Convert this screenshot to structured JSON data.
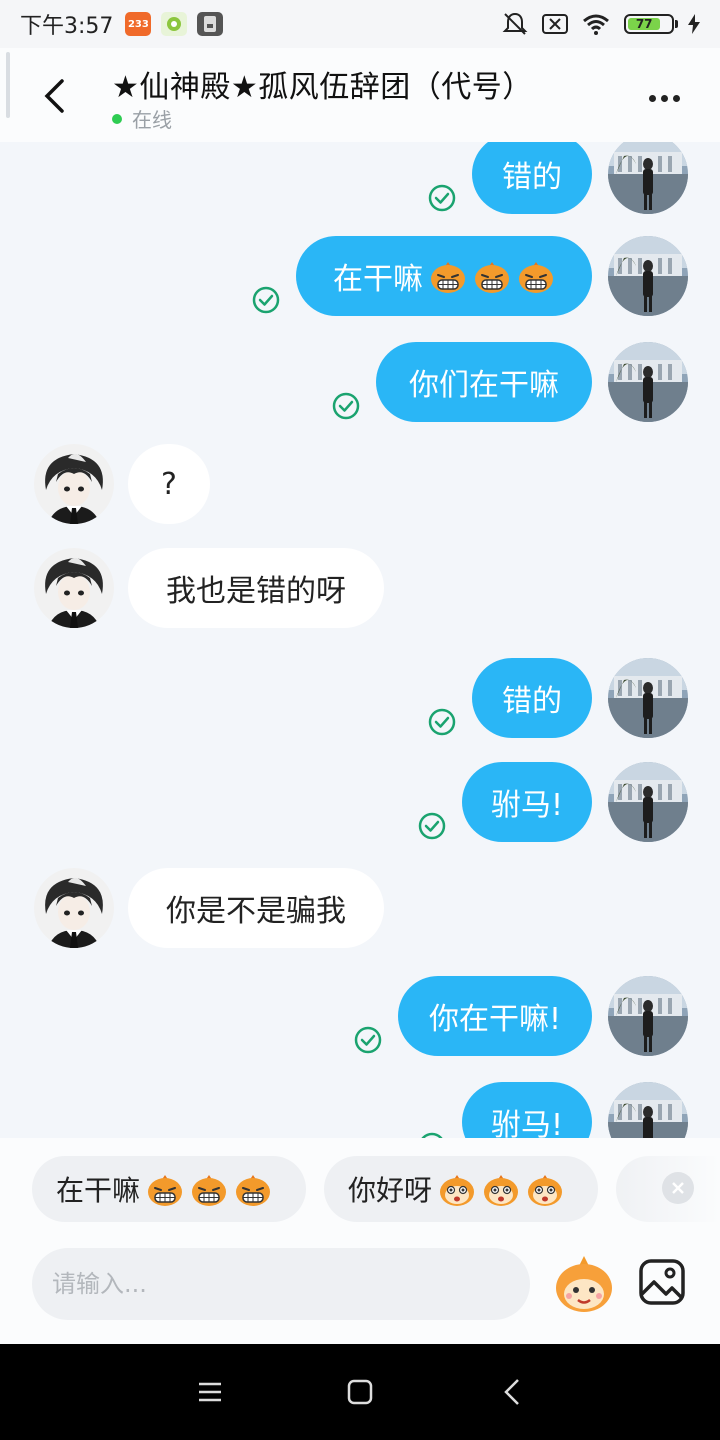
{
  "status_bar": {
    "time": "下午3:57",
    "app_badge": "233",
    "battery_level": "77"
  },
  "header": {
    "title": "★仙神殿★孤风伍辞团（代号）",
    "status": "在线",
    "online_color": "#2ecc52"
  },
  "colors": {
    "outgoing_bubble": "#2ab6f6",
    "incoming_bubble": "#ffffff",
    "check": "#1aa36f",
    "background": "#f3f6fa"
  },
  "messages": [
    {
      "dir": "out",
      "text": "错的",
      "emojis": 0
    },
    {
      "dir": "out",
      "text": "在干嘛",
      "emojis": 3
    },
    {
      "dir": "out",
      "text": "你们在干嘛",
      "emojis": 0
    },
    {
      "dir": "in",
      "text": "?",
      "emojis": 0
    },
    {
      "dir": "in",
      "text": "我也是错的呀",
      "emojis": 0
    },
    {
      "dir": "out",
      "text": "错的",
      "emojis": 0
    },
    {
      "dir": "out",
      "text": "驸马!",
      "emojis": 0
    },
    {
      "dir": "in",
      "text": "你是不是骗我",
      "emojis": 0
    },
    {
      "dir": "out",
      "text": "你在干嘛!",
      "emojis": 0
    },
    {
      "dir": "out",
      "text": "驸马!",
      "emojis": 0
    }
  ],
  "quick_replies": [
    {
      "text": "在干嘛",
      "emojis": 3
    },
    {
      "text": "你好呀",
      "emojis": 3
    }
  ],
  "input": {
    "placeholder": "请输入...",
    "value": ""
  },
  "icons": {
    "back": "chevron-left-icon",
    "more": "more-dots-icon",
    "emoji": "monkey-emoji-icon",
    "image": "image-icon",
    "nav_menu": "menu-icon",
    "nav_home": "home-square-icon",
    "nav_back": "back-triangle-icon"
  }
}
